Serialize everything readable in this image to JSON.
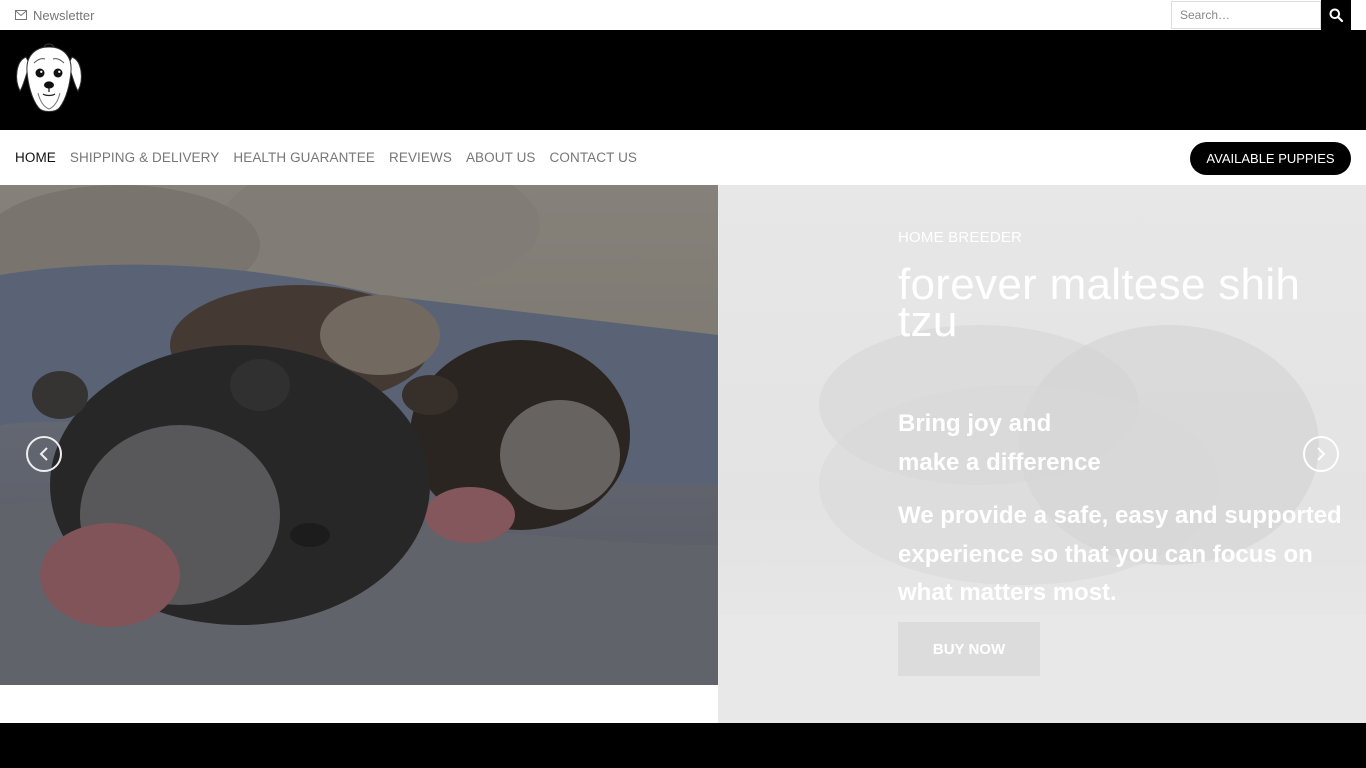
{
  "topbar": {
    "newsletter_label": "Newsletter",
    "search_placeholder": "Search…"
  },
  "nav": {
    "items": [
      {
        "label": "HOME",
        "active": true
      },
      {
        "label": "SHIPPING & DELIVERY"
      },
      {
        "label": "HEALTH GUARANTEE"
      },
      {
        "label": "REVIEWS"
      },
      {
        "label": "ABOUT US"
      },
      {
        "label": "CONTACT US"
      }
    ],
    "cta_label": "AVAILABLE PUPPIES"
  },
  "hero": {
    "eyebrow": "HOME BREEDER",
    "title": "forever maltese shih tzu",
    "subtitle_line1": "Bring joy and",
    "subtitle_line2": "make a difference",
    "description": "We provide a safe, easy and supported experience so that you can focus on what matters most.",
    "button_label": "BUY NOW"
  },
  "colors": {
    "header_bg": "#000000",
    "cta_bg": "#000000",
    "text_muted": "#777777"
  },
  "icons": [
    "envelope-icon",
    "search-icon",
    "shih-tzu-logo",
    "chevron-left-icon",
    "chevron-right-icon"
  ]
}
